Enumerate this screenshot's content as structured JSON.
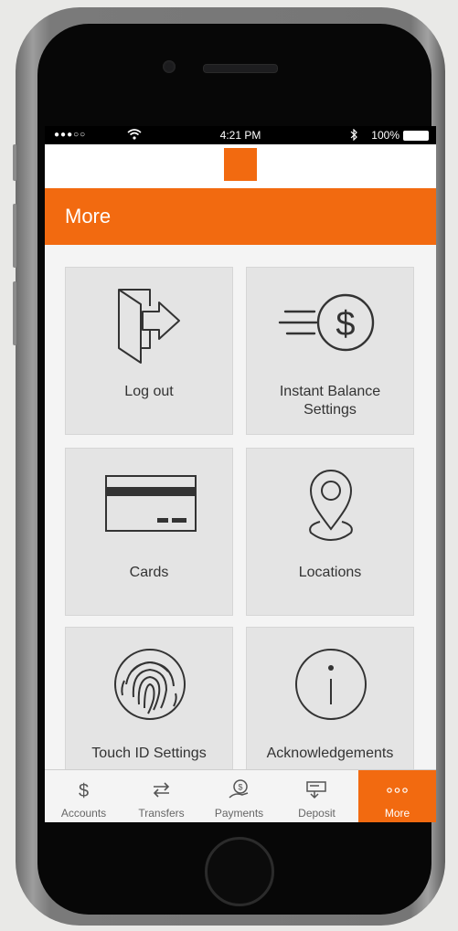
{
  "status_bar": {
    "signal": "●●●○○",
    "time": "4:21 PM",
    "battery": "100%"
  },
  "header": {
    "title": "More"
  },
  "tiles": [
    {
      "label": "Log out",
      "icon": "logout-icon"
    },
    {
      "label": "Instant Balance\nSettings",
      "label_line1": "Instant Balance",
      "label_line2": "Settings",
      "icon": "instant-balance-icon"
    },
    {
      "label": "Cards",
      "icon": "credit-card-icon"
    },
    {
      "label": "Locations",
      "icon": "location-pin-icon"
    },
    {
      "label": "Touch ID Settings",
      "icon": "fingerprint-icon"
    },
    {
      "label": "Acknowledgements",
      "icon": "info-icon"
    }
  ],
  "tabbar": {
    "tabs": [
      {
        "label": "Accounts",
        "icon": "dollar-icon"
      },
      {
        "label": "Transfers",
        "icon": "transfer-icon"
      },
      {
        "label": "Payments",
        "icon": "payments-icon"
      },
      {
        "label": "Deposit",
        "icon": "deposit-icon"
      },
      {
        "label": "More",
        "icon": "more-dots-icon",
        "active": true
      }
    ]
  },
  "colors": {
    "brand_orange": "#f26a10",
    "tile_bg": "#e4e4e4",
    "icon_stroke": "#333333"
  }
}
